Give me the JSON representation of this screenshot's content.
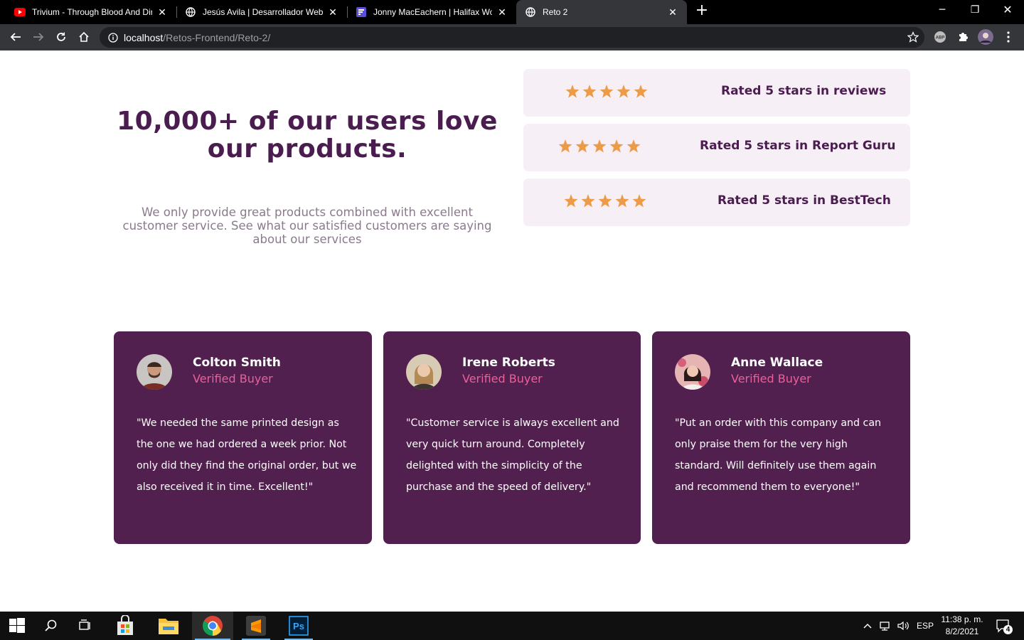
{
  "browser": {
    "tabs": [
      {
        "title": "Trivium - Through Blood And Dirt",
        "icon": "youtube-icon"
      },
      {
        "title": "Jesús Avila | Desarrollador Web",
        "icon": "globe-icon"
      },
      {
        "title": "Jonny MacEachern | Halifax WordPress",
        "icon": "site-favicon-icon"
      },
      {
        "title": "Reto 2",
        "icon": "globe-icon"
      }
    ],
    "url_host": "localhost",
    "url_path": "/Retos-Frontend/Reto-2/"
  },
  "hero": {
    "title": "10,000+ of our users love our products.",
    "description": "We only provide great products combined with excellent customer service. See what our satisfied customers are saying about our services"
  },
  "ratings": [
    {
      "label": "Rated 5 stars in reviews",
      "stars": 5
    },
    {
      "label": "Rated 5 stars in Report Guru",
      "stars": 5
    },
    {
      "label": "Rated 5 stars in BestTech",
      "stars": 5
    }
  ],
  "testimonials": [
    {
      "name": "Colton Smith",
      "role": "Verified Buyer",
      "quote": "\"We needed the same printed design as the one we had ordered a week prior. Not only did they find the original order, but we also received it in time. Excellent!\""
    },
    {
      "name": "Irene Roberts",
      "role": "Verified Buyer",
      "quote": "\"Customer service is always excellent and very quick turn around. Completely delighted with the simplicity of the purchase and the speed of delivery.\""
    },
    {
      "name": "Anne Wallace",
      "role": "Verified Buyer",
      "quote": "\"Put an order with this company and can only praise them for the very high standard. Will definitely use them again and recommend them to everyone!\""
    }
  ],
  "taskbar": {
    "language": "ESP",
    "time": "11:38 p. m.",
    "date": "8/2/2021",
    "notification_count": "4"
  },
  "colors": {
    "brand_purple": "#52204f",
    "title_purple": "#4b1c4f",
    "star_orange": "#ee9b47",
    "accent_pink": "#e8609c",
    "rating_bg": "#f6eff6"
  }
}
